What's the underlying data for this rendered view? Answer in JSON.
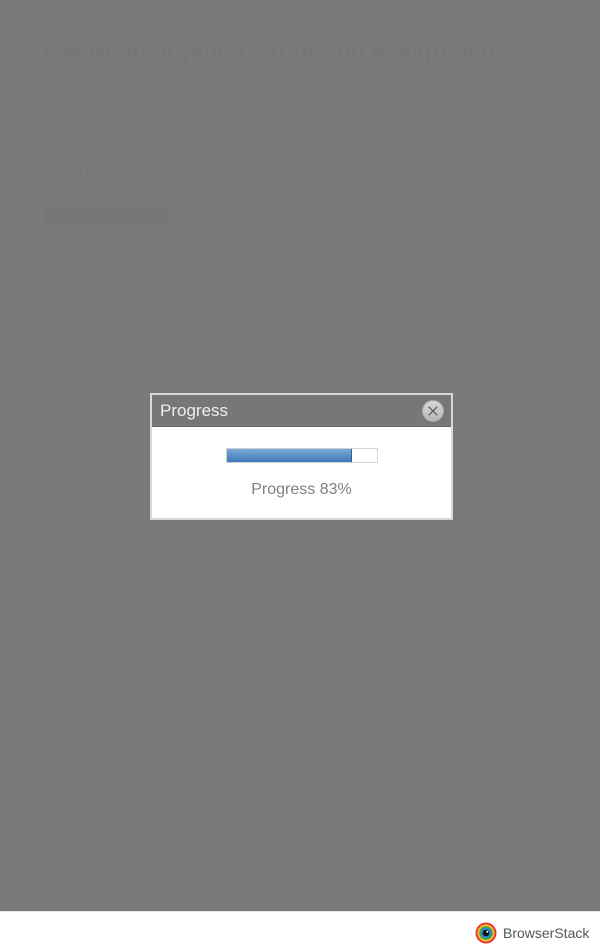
{
  "page": {
    "title": "The White Agency, Front-end assignment",
    "section_title": "Lightbox loading",
    "reset_button_label": "Reset the light box"
  },
  "lightbox": {
    "title": "Progress",
    "progress_value": 83,
    "progress_text": "Progress 83%",
    "close_icon": "close-icon"
  },
  "footer": {
    "brand": "BrowserStack",
    "logo_icon": "browserstack-logo-icon"
  },
  "colors": {
    "overlay": "#767875",
    "progress_fill": "#4a86c5",
    "text_dark": "#4a4a4a"
  }
}
